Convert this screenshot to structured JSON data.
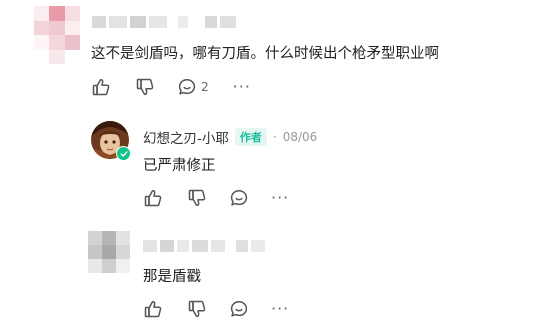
{
  "comments": [
    {
      "text": "这不是剑盾吗，哪有刀盾。什么时候出个枪矛型职业啊",
      "reply_count": "2",
      "more": "···"
    },
    {
      "author": "幻想之刃-小耶",
      "author_badge": "作者",
      "date_separator": "·",
      "date": "08/06",
      "text": "已严肃修正",
      "more": "···"
    },
    {
      "text": "那是盾戳",
      "more": "···"
    }
  ],
  "icons": {
    "like": "thumbs-up-icon",
    "dislike": "thumbs-down-icon",
    "reply": "comment-bubble-icon",
    "more": "more-dots-icon",
    "verified": "verified-check-icon"
  },
  "colors": {
    "badge_text": "#1abc9c",
    "badge_bg": "#e6f7f2",
    "verified": "#10c48a"
  }
}
